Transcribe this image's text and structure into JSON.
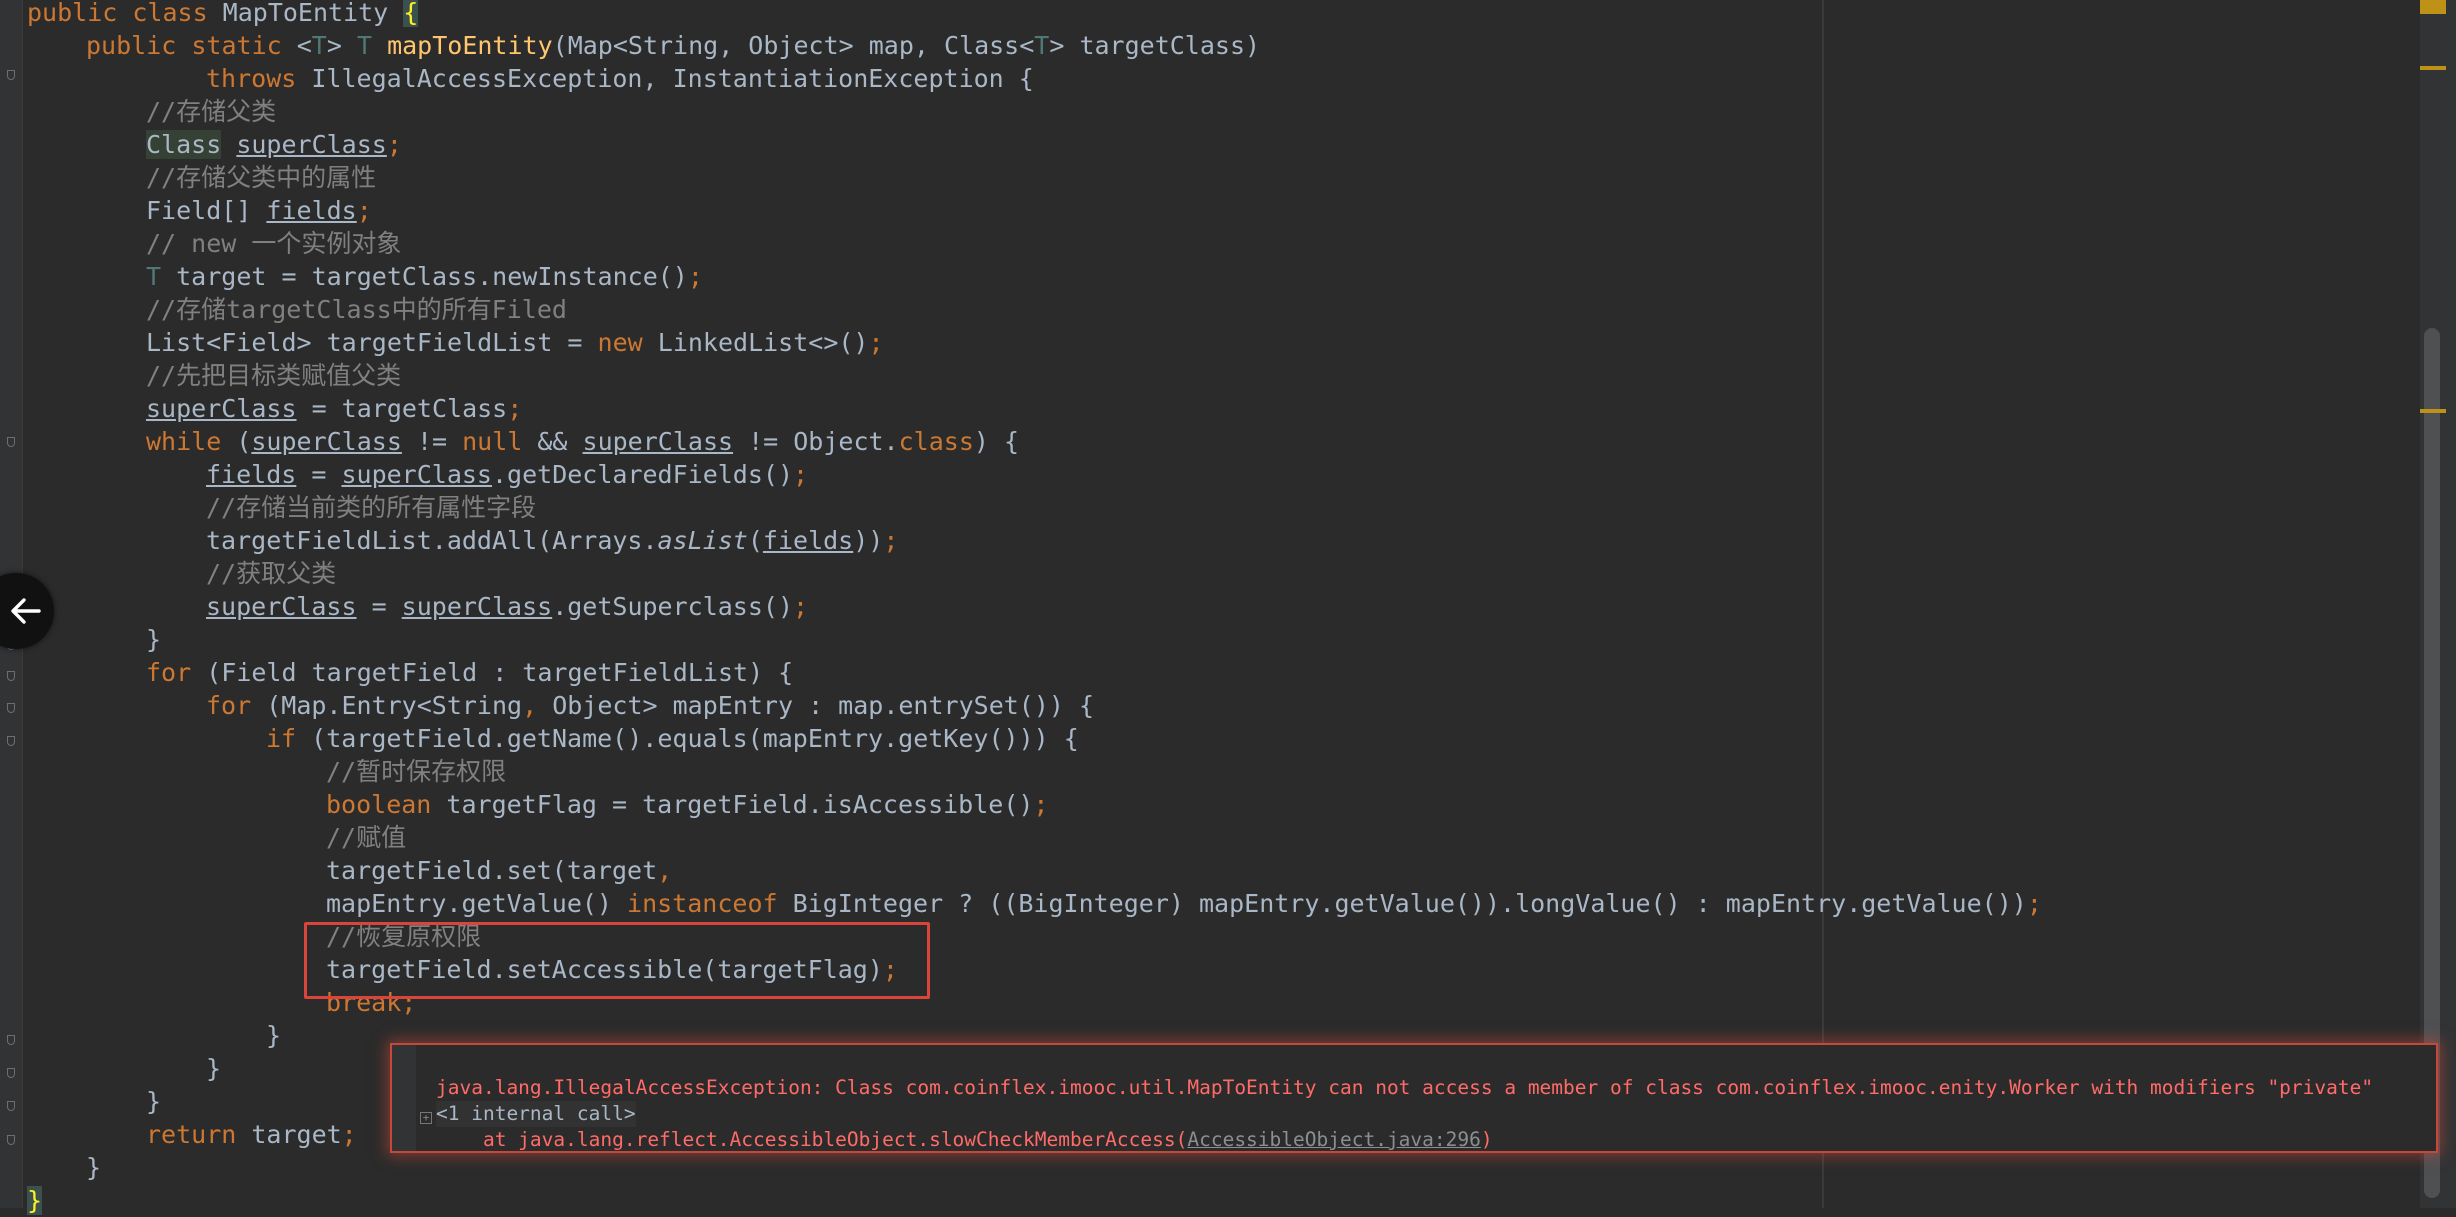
{
  "code": {
    "l0": {
      "kw1": "public ",
      "kw2": "class ",
      "name": "MapToEntity ",
      "brace": "{"
    },
    "l1": {
      "kw1": "public ",
      "kw2": "static ",
      "lt": "<",
      "t1": "T",
      "gt": "> ",
      "t2": "T ",
      "fn": "mapToEntity",
      "rest": "(Map<String, Object> map, Class<",
      "t3": "T",
      "rest2": "> targetClass)"
    },
    "l2": {
      "kw": "throws ",
      "rest": "IllegalAccessException, InstantiationException {"
    },
    "l3": "//存储父类",
    "l4": {
      "type": "Class",
      "sp": " ",
      "var": "superClass",
      "semi": ";"
    },
    "l5": "//存储父类中的属性",
    "l6": {
      "type": "Field[] ",
      "var": "fields",
      "semi": ";"
    },
    "l7": "// new 一个实例对象",
    "l8": {
      "t": "T ",
      "rest": "target = targetClass.newInstance()",
      "semi": ";"
    },
    "l9": "//存储targetClass中的所有Filed",
    "l10": {
      "a": "List<Field> targetFieldList = ",
      "kw": "new ",
      "b": "LinkedList<>()",
      "semi": ";"
    },
    "l11": "//先把目标类赋值父类",
    "l12": {
      "var": "superClass",
      "rest": " = targetClass",
      "semi": ";"
    },
    "l13": {
      "kw": "while ",
      "p": "(",
      "v1": "superClass",
      "op": " != ",
      "kw2": "null ",
      "and": "&& ",
      "v2": "superClass",
      "op2": " != Object.",
      "kw3": "class",
      "end": ") {"
    },
    "l14": {
      "v1": "fields",
      "eq": " = ",
      "v2": "superClass",
      "rest": ".getDeclaredFields()",
      "semi": ";"
    },
    "l15": "//存储当前类的所有属性字段",
    "l16": {
      "a": "targetFieldList.addAll(Arrays.",
      "it": "asList",
      "p": "(",
      "v": "fields",
      "end": "))",
      "semi": ";"
    },
    "l17": "//获取父类",
    "l18": {
      "v1": "superClass",
      "eq": " = ",
      "v2": "superClass",
      "rest": ".getSuperclass()",
      "semi": ";"
    },
    "l19": "}",
    "l20": {
      "kw": "for ",
      "rest": "(Field targetField : targetFieldList) {"
    },
    "l21": {
      "kw": "for ",
      "rest": "(Map.Entry<String",
      "comma": ", ",
      "rest2": "Object> mapEntry : map.entrySet()) {"
    },
    "l22": {
      "kw": "if ",
      "rest": "(targetField.getName().equals(mapEntry.getKey())) {"
    },
    "l23": "//暂时保存权限",
    "l24": {
      "kw": "boolean ",
      "rest": "targetFlag = targetField.isAccessible()",
      "semi": ";"
    },
    "l25": "//赋值",
    "l26": {
      "rest": "targetField.set(target",
      "comma": ","
    },
    "l27": {
      "a": "mapEntry.getValue() ",
      "kw": "instanceof ",
      "b": "BigInteger ? ((BigInteger) mapEntry.getValue()).longValue() : mapEntry.getValue())",
      "semi": ";"
    },
    "l28": "//恢复原权限",
    "l29": {
      "rest": "targetField.setAccessible(targetFlag)",
      "semi": ";"
    },
    "l30": {
      "kw": "break",
      "semi": ";"
    },
    "l31": "}",
    "l32": "}",
    "l33": "}",
    "l34": {
      "kw": "return ",
      "rest": "target",
      "semi": ";"
    },
    "l35": "}",
    "l36": "}"
  },
  "popup": {
    "exception": "java.lang.IllegalAccessException: Class com.coinflex.imooc.util.MapToEntity can not access a member of class com.coinflex.imooc.enity.Worker with modifiers \"private\"",
    "internal_call": "<1 internal call>",
    "at_prefix": "    at java.lang.reflect.AccessibleObject.slowCheckMemberAccess(",
    "at_link": "AccessibleObject.java:296",
    "at_suffix": ")"
  },
  "icons": {
    "back": "arrow-left-icon",
    "expand": "plus-square-icon"
  },
  "colors": {
    "background": "#2b2b2b",
    "keyword": "#cc7832",
    "comment": "#808080",
    "method": "#ffc66d",
    "error": "#ff6b68",
    "highlight_box": "#d9453a"
  }
}
